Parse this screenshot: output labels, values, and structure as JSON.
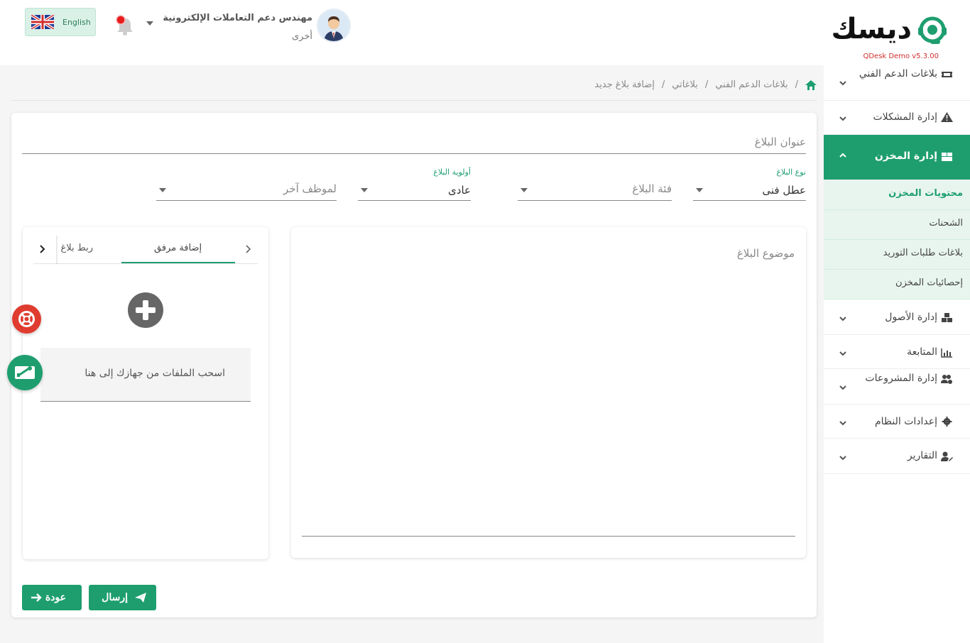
{
  "header": {
    "logo_text": "ديسك",
    "version": "QDesk Demo v5.3.00",
    "user_name": "مهندس دعم التعاملات الإلكترونية",
    "user_role": "أخرى",
    "language_label": "English"
  },
  "breadcrumb": {
    "items": [
      "بلاغات الدعم الفني",
      "بلاغاتي",
      "إضافة بلاغ جديد"
    ],
    "separator": "/"
  },
  "sidebar": {
    "items": [
      {
        "label": "بلاغات الدعم الفني",
        "icon": "ticket-icon"
      },
      {
        "label": "إدارة المشكلات",
        "icon": "warning-icon"
      },
      {
        "label": "إدارة المخزن",
        "icon": "boxes-icon"
      },
      {
        "label": "إدارة الأصول",
        "icon": "cubes-icon"
      },
      {
        "label": "المتابعة",
        "icon": "chart-icon"
      },
      {
        "label": "إدارة المشروعات",
        "icon": "users-cog-icon"
      },
      {
        "label": "إعدادات النظام",
        "icon": "gear-icon"
      },
      {
        "label": "التقارير",
        "icon": "user-edit-icon"
      }
    ],
    "subitems": [
      "محتويات المخزن",
      "الشحنات",
      "بلاغات طلبات التوريد",
      "إحصائيات المخزن"
    ]
  },
  "form": {
    "title_placeholder": "عنوان البلاغ",
    "type_label": "نوع البلاغ",
    "type_value": "عطل فنى",
    "category_placeholder": "فئة البلاغ",
    "priority_label": "أولوية البلاغ",
    "priority_value": "عادى",
    "assignee_placeholder": "لموظف آخر",
    "subject_placeholder": "موضوع البلاغ"
  },
  "attachments": {
    "tab_add": "إضافة مرفق",
    "tab_link": "ربط بلاغ",
    "drop_text": "اسحب الملفات من جهازك إلى هنا"
  },
  "actions": {
    "send_label": "إرسال",
    "back_label": "عودة"
  },
  "colors": {
    "primary": "#1e9e6f",
    "danger": "#e03b2f"
  }
}
